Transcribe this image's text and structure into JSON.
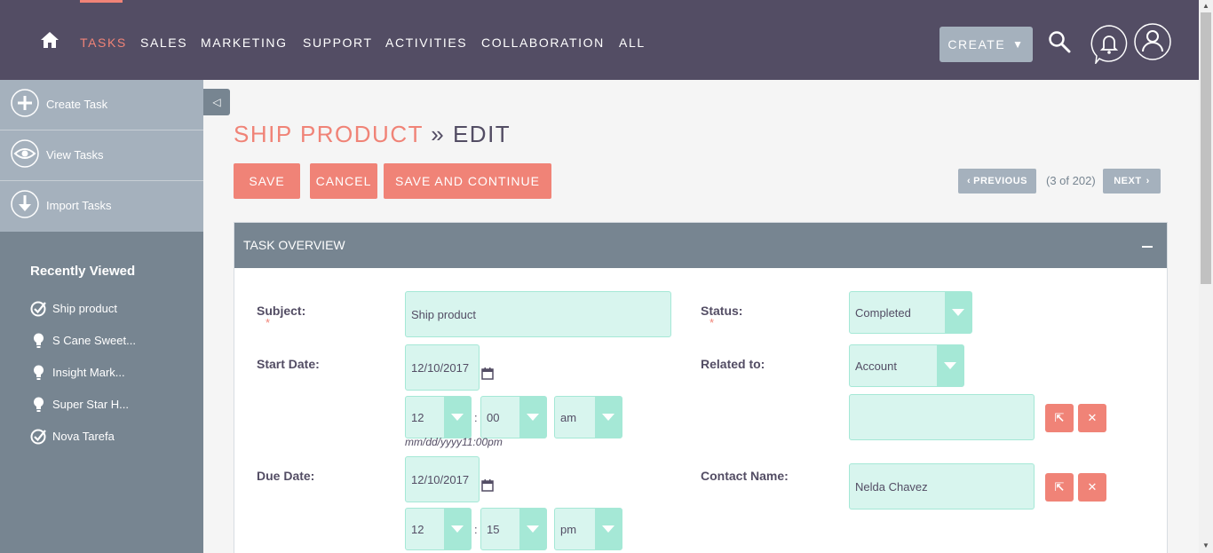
{
  "nav": {
    "items": [
      "TASKS",
      "SALES",
      "MARKETING",
      "SUPPORT",
      "ACTIVITIES",
      "COLLABORATION",
      "ALL"
    ],
    "active": "TASKS",
    "create_label": "CREATE",
    "icons": [
      "home-icon",
      "search-icon",
      "bell-icon",
      "user-icon"
    ]
  },
  "sidebar": {
    "actions": [
      {
        "label": "Create Task",
        "icon": "plus-circle-icon"
      },
      {
        "label": "View Tasks",
        "icon": "eye-icon"
      },
      {
        "label": "Import Tasks",
        "icon": "download-icon"
      }
    ],
    "recent_title": "Recently Viewed",
    "recent": [
      {
        "label": "Ship product",
        "icon": "task-icon"
      },
      {
        "label": "S Cane Sweet...",
        "icon": "lightbulb-icon"
      },
      {
        "label": "Insight Mark...",
        "icon": "lightbulb-icon"
      },
      {
        "label": "Super Star H...",
        "icon": "lightbulb-icon"
      },
      {
        "label": "Nova Tarefa",
        "icon": "task-icon"
      }
    ]
  },
  "page": {
    "title_record": "SHIP PRODUCT",
    "title_sep": "»",
    "title_mode": "EDIT"
  },
  "buttons": {
    "save": "SAVE",
    "cancel": "CANCEL",
    "save_continue": "SAVE AND CONTINUE",
    "previous": "PREVIOUS",
    "next": "NEXT",
    "count": "(3 of 202)"
  },
  "panel": {
    "title": "TASK OVERVIEW",
    "subject_label": "Subject:",
    "subject_value": "Ship product",
    "status_label": "Status:",
    "status_value": "Completed",
    "start_label": "Start Date:",
    "start_date": "12/10/2017",
    "start_hour": "12",
    "start_min": "00",
    "start_ampm": "am",
    "date_format": "mm/dd/yyyy11:00pm",
    "related_label": "Related to:",
    "related_value": "Account",
    "related_name": "",
    "due_label": "Due Date:",
    "due_date": "12/10/2017",
    "due_hour": "12",
    "due_min": "15",
    "due_ampm": "pm",
    "contact_label": "Contact Name:",
    "contact_value": "Nelda Chavez",
    "required_mark": "*",
    "time_sep": ":"
  },
  "colors": {
    "nav_bg": "#534d64",
    "accent": "#f08377",
    "sidebar_bg": "#778591",
    "field_bg": "#d8f5ee",
    "field_accent": "#a5e8d6"
  }
}
